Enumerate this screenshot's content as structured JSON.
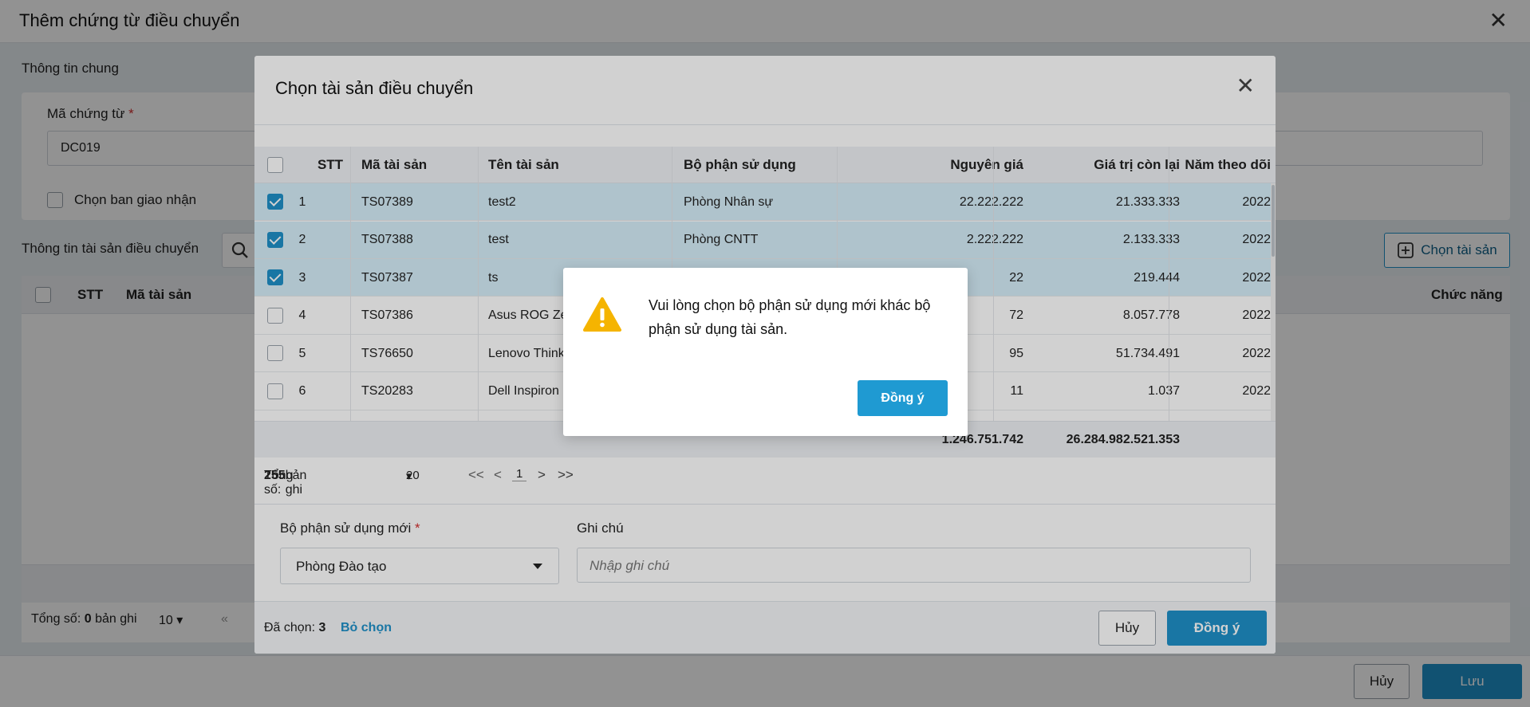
{
  "page": {
    "title": "Thêm chứng từ điều chuyển",
    "general_section_label": "Thông tin chung",
    "doc_code_label": "Mã chứng từ",
    "required_mark": "*",
    "doc_code_value": "DC019",
    "handover_checkbox_label": "Chọn ban giao nhận",
    "asset_section_label": "Thông tin tài sản điều chuyển",
    "choose_asset_button": "Chọn tài sản",
    "table_headers": {
      "stt": "STT",
      "code": "Mã tài sản",
      "function": "Chức năng"
    },
    "pager_total_prefix": "Tổng số:",
    "pager_total_count": "0",
    "pager_total_suffix": "bản ghi",
    "pager_page_size": "10",
    "cancel_button": "Hủy",
    "save_button": "Lưu"
  },
  "modal": {
    "title": "Chọn tài sản điều chuyển",
    "columns": {
      "stt": "STT",
      "code": "Mã tài sản",
      "name": "Tên tài sản",
      "dept": "Bộ phận sử dụng",
      "cost": "Nguyên giá",
      "remaining": "Giá trị còn lại",
      "year": "Năm theo dõi"
    },
    "rows": [
      {
        "stt": "1",
        "code": "TS07389",
        "name": "test2",
        "dept": "Phòng Nhân sự",
        "cost": "22.222.222",
        "remaining": "21.333.333",
        "year": "2022",
        "checked": true
      },
      {
        "stt": "2",
        "code": "TS07388",
        "name": "test",
        "dept": "Phòng CNTT",
        "cost": "2.222.222",
        "remaining": "2.133.333",
        "year": "2022",
        "checked": true
      },
      {
        "stt": "3",
        "code": "TS07387",
        "name": "ts",
        "dept": "",
        "cost": "22",
        "remaining": "219.444",
        "year": "2022",
        "checked": true
      },
      {
        "stt": "4",
        "code": "TS07386",
        "name": "Asus ROG Ze",
        "dept": "",
        "cost": "72",
        "remaining": "8.057.778",
        "year": "2022",
        "checked": false
      },
      {
        "stt": "5",
        "code": "TS76650",
        "name": "Lenovo Think",
        "dept": "",
        "cost": "95",
        "remaining": "51.734.491",
        "year": "2022",
        "checked": false
      },
      {
        "stt": "6",
        "code": "TS20283",
        "name": "Dell Inspiron",
        "dept": "",
        "cost": "11",
        "remaining": "1.037",
        "year": "2022",
        "checked": false
      }
    ],
    "sum_cost": "1.246.751.742",
    "sum_remaining": "26.284.982.521.353",
    "pager_total_prefix": "Tổng số:",
    "pager_total_count": "255",
    "pager_total_suffix": "bản ghi",
    "pager_page_size": "20",
    "pager_first": "<<",
    "pager_prev": "<",
    "pager_current": "1",
    "pager_next": ">",
    "pager_last": ">>",
    "new_dept_label": "Bộ phận sử dụng mới",
    "new_dept_value": "Phòng Đào tạo",
    "note_label": "Ghi chú",
    "note_placeholder": "Nhập ghi chú",
    "selected_label": "Đã chọn:",
    "selected_count": "3",
    "deselect_link": "Bỏ chọn",
    "cancel_button": "Hủy",
    "confirm_button": "Đồng ý"
  },
  "alert": {
    "icon": "warning-icon",
    "message": "Vui lòng chọn bộ phận sử dụng mới khác bộ phận sử dụng tài sản.",
    "confirm_button": "Đồng ý"
  },
  "colors": {
    "primary": "#1f90c9",
    "warning": "#f5b400",
    "selected_row": "#d6eef9"
  }
}
